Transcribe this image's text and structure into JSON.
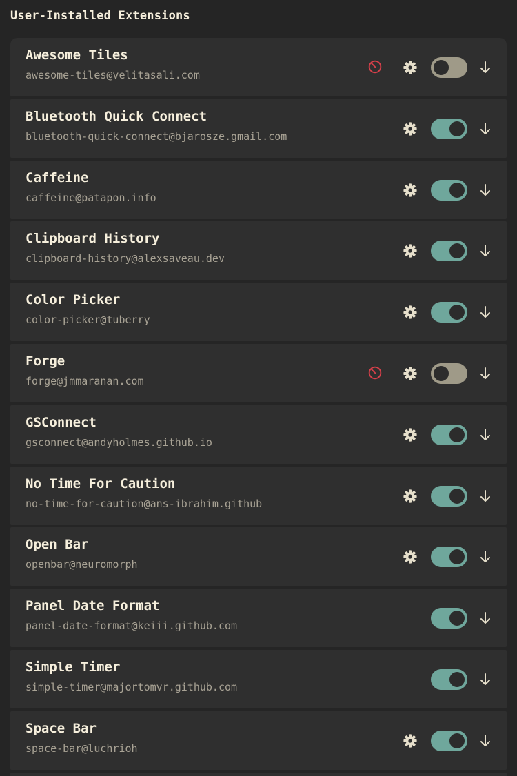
{
  "section": {
    "title": "User-Installed Extensions"
  },
  "colors": {
    "background": "#252525",
    "row": "#2f2f2f",
    "toggle_on": "#6fa79c",
    "toggle_off": "#9f9a88",
    "error": "#d8404a",
    "text": "#f6efdc",
    "subtext": "#a9a395"
  },
  "extensions": [
    {
      "name": "Awesome Tiles",
      "uuid": "awesome-tiles@velitasali.com",
      "enabled": false,
      "error": true,
      "settings": true
    },
    {
      "name": "Bluetooth Quick Connect",
      "uuid": "bluetooth-quick-connect@bjarosze.gmail.com",
      "enabled": true,
      "error": false,
      "settings": true
    },
    {
      "name": "Caffeine",
      "uuid": "caffeine@patapon.info",
      "enabled": true,
      "error": false,
      "settings": true
    },
    {
      "name": "Clipboard History",
      "uuid": "clipboard-history@alexsaveau.dev",
      "enabled": true,
      "error": false,
      "settings": true
    },
    {
      "name": "Color Picker",
      "uuid": "color-picker@tuberry",
      "enabled": true,
      "error": false,
      "settings": true
    },
    {
      "name": "Forge",
      "uuid": "forge@jmmaranan.com",
      "enabled": false,
      "error": true,
      "settings": true
    },
    {
      "name": "GSConnect",
      "uuid": "gsconnect@andyholmes.github.io",
      "enabled": true,
      "error": false,
      "settings": true
    },
    {
      "name": "No Time For Caution",
      "uuid": "no-time-for-caution@ans-ibrahim.github",
      "enabled": true,
      "error": false,
      "settings": true
    },
    {
      "name": "Open Bar",
      "uuid": "openbar@neuromorph",
      "enabled": true,
      "error": false,
      "settings": true
    },
    {
      "name": "Panel Date Format",
      "uuid": "panel-date-format@keiii.github.com",
      "enabled": true,
      "error": false,
      "settings": false
    },
    {
      "name": "Simple Timer",
      "uuid": "simple-timer@majortomvr.github.com",
      "enabled": true,
      "error": false,
      "settings": false
    },
    {
      "name": "Space Bar",
      "uuid": "space-bar@luchrioh",
      "enabled": true,
      "error": false,
      "settings": true
    }
  ],
  "icons": {
    "error": "error-icon",
    "settings": "gear-icon",
    "expand": "arrow-down-icon"
  }
}
